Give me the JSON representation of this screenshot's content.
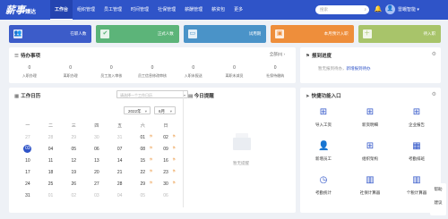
{
  "header": {
    "logo": "薪事",
    "logo_suffix": "臻达",
    "nav": [
      "工作台",
      "组织管理",
      "员工管理",
      "时间管理",
      "社保管理",
      "薪酬管理",
      "薪资包",
      "更多"
    ],
    "search_placeholder": "搜索",
    "user": "雷蛾智能"
  },
  "stats": [
    {
      "label": "在职人数",
      "color": "#3c5cc9",
      "icon": "people-icon"
    },
    {
      "label": "正式人数",
      "color": "#5cb479",
      "icon": "user-check-icon"
    },
    {
      "label": "试用期",
      "color": "#4a93c8",
      "icon": "id-card-icon"
    },
    {
      "label": "本月预计入职",
      "color": "#ee8e3b",
      "icon": "briefcase-icon"
    },
    {
      "label": "待入职",
      "color": "#a8c46a",
      "icon": "user-plus-icon"
    }
  ],
  "todo": {
    "title": "待办事项",
    "more": "全部(0)",
    "items": [
      {
        "value": "0",
        "label": "入职办理"
      },
      {
        "value": "0",
        "label": "离职办理"
      },
      {
        "value": "0",
        "label": "员工加入审核"
      },
      {
        "value": "0",
        "label": "员工信息修改审核"
      },
      {
        "value": "0",
        "label": "入职未报送"
      },
      {
        "value": "0",
        "label": "离职未减员"
      },
      {
        "value": "0",
        "label": "社保待缴纳"
      }
    ]
  },
  "onboard": {
    "title": "报到进度",
    "msg_prefix": "暂无报到待办，",
    "msg_link": "新增报到待办"
  },
  "calendar": {
    "title": "工作日历",
    "select_placeholder": "请选择一个工作日历",
    "year": "2022年",
    "month": "6月",
    "weekdays": [
      "一",
      "二",
      "三",
      "四",
      "五",
      "六",
      "日"
    ],
    "weeks": [
      [
        {
          "d": "27",
          "m": true
        },
        {
          "d": "28",
          "m": true
        },
        {
          "d": "29",
          "m": true
        },
        {
          "d": "30",
          "m": true
        },
        {
          "d": "31",
          "m": true
        },
        {
          "d": "01",
          "rest": "休"
        },
        {
          "d": "02",
          "rest": "休"
        }
      ],
      [
        {
          "d": "03",
          "today": true
        },
        {
          "d": "04"
        },
        {
          "d": "05"
        },
        {
          "d": "06"
        },
        {
          "d": "07"
        },
        {
          "d": "08",
          "rest": "休"
        },
        {
          "d": "09",
          "rest": "休"
        }
      ],
      [
        {
          "d": "10"
        },
        {
          "d": "11"
        },
        {
          "d": "12"
        },
        {
          "d": "13"
        },
        {
          "d": "14"
        },
        {
          "d": "15",
          "rest": "休"
        },
        {
          "d": "16",
          "rest": "休"
        }
      ],
      [
        {
          "d": "17"
        },
        {
          "d": "18"
        },
        {
          "d": "19"
        },
        {
          "d": "20"
        },
        {
          "d": "21"
        },
        {
          "d": "22",
          "rest": "休"
        },
        {
          "d": "23",
          "rest": "休"
        }
      ],
      [
        {
          "d": "24"
        },
        {
          "d": "25"
        },
        {
          "d": "26"
        },
        {
          "d": "27"
        },
        {
          "d": "28"
        },
        {
          "d": "29",
          "rest": "休"
        },
        {
          "d": "30",
          "rest": "休"
        }
      ],
      [
        {
          "d": "31"
        },
        {
          "d": "01",
          "m": true
        },
        {
          "d": "02",
          "m": true
        },
        {
          "d": "03",
          "m": true
        },
        {
          "d": "04",
          "m": true
        },
        {
          "d": "05",
          "m": true
        },
        {
          "d": "06",
          "m": true
        }
      ]
    ],
    "reminder_title": "今日提醒",
    "empty": "暂无提醒"
  },
  "quick": {
    "title": "快捷功能入口",
    "items": [
      {
        "label": "导入工资",
        "icon": "sitemap-icon"
      },
      {
        "label": "新资明细",
        "icon": "sitemap-icon"
      },
      {
        "label": "企业报告",
        "icon": "sitemap-icon"
      },
      {
        "label": "新增员工",
        "icon": "user-icon"
      },
      {
        "label": "组织架构",
        "icon": "sitemap-icon"
      },
      {
        "label": "考勤排班",
        "icon": "calendar-icon"
      },
      {
        "label": "考勤统计",
        "icon": "clock-icon"
      },
      {
        "label": "社保计算器",
        "icon": "calculator-icon"
      },
      {
        "label": "个税计算器",
        "icon": "calculator-icon"
      }
    ]
  },
  "float": {
    "help": "帮助",
    "suggest": "建议"
  }
}
